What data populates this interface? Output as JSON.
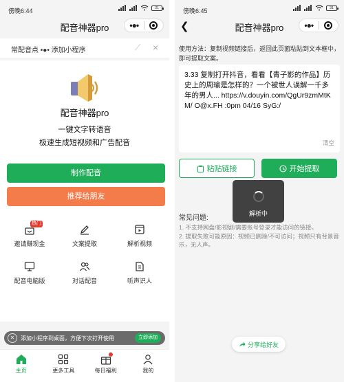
{
  "left": {
    "status": {
      "time": "傍晚6:44",
      "battery": "31"
    },
    "nav": {
      "title": "配音神器pro"
    },
    "tip_banner": {
      "text": "常配音点 •●• 添加小程序"
    },
    "app": {
      "name": "配音神器pro",
      "slogan1": "一键文字转语音",
      "slogan2": "极速生成短视频和广告配音"
    },
    "buttons": {
      "make": "制作配音",
      "share": "推荐给朋友"
    },
    "features": [
      {
        "label": "邀请赚现金",
        "icon": "gift-icon",
        "badge": "热门"
      },
      {
        "label": "文案提取",
        "icon": "pen-icon"
      },
      {
        "label": "解析视频",
        "icon": "video-icon"
      },
      {
        "label": "配音电脑版",
        "icon": "monitor-icon"
      },
      {
        "label": "对话配音",
        "icon": "users-icon"
      },
      {
        "label": "听声识人",
        "icon": "document-icon"
      }
    ],
    "toast": {
      "text": "添加小程序到桌面，方便下次打开使用",
      "button": "立即添加"
    },
    "tabs": [
      {
        "label": "主页",
        "icon": "home-icon",
        "active": true
      },
      {
        "label": "更多工具",
        "icon": "grid-icon"
      },
      {
        "label": "每日福利",
        "icon": "gift-box-icon"
      },
      {
        "label": "我的",
        "icon": "user-icon"
      }
    ]
  },
  "right": {
    "status": {
      "time": "傍晚6:45",
      "battery": "31"
    },
    "nav": {
      "title": "配音神器pro"
    },
    "usage": "使用方法：复制视频链接后，返回此页面粘贴到文本框中，即可提取文案。",
    "link_text": "3.33 复制打开抖音，看看【青子影的作品】历史上的周瑜是怎样的？一个被世人误解一千多年的男人... https://v.douyin.com/QgUr9zmMtKM/ O@x.FH :0pm 04/16 SyG:/",
    "clear": "清空",
    "buttons": {
      "paste": "粘贴链接",
      "extract": "开始提取"
    },
    "faq": {
      "title": "常见问题:",
      "item1": "1. 不支持网盘/影视剧/需要账号登录才能访问的链接。",
      "item2": "2. 提取失败可能原因：视频已删除/不可访问；视频只有背景音乐，无人声。"
    },
    "loading": "解析中",
    "share": "分享给好友"
  },
  "colors": {
    "primary": "#1fad5a",
    "accent": "#f47b4a",
    "badge": "#e23b2e"
  }
}
